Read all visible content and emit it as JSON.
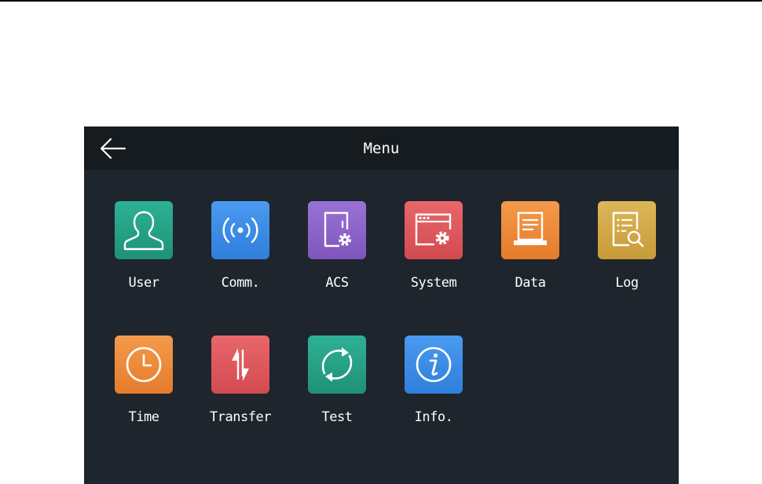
{
  "header": {
    "title": "Menu",
    "back_icon": "arrow-left-icon"
  },
  "menu_items": [
    {
      "id": "user",
      "label": "User",
      "icon": "user-icon",
      "color": "#25a389"
    },
    {
      "id": "comm",
      "label": "Comm.",
      "icon": "wireless-signal-icon",
      "color": "#3d8ee8"
    },
    {
      "id": "acs",
      "label": "ACS",
      "icon": "door-settings-icon",
      "color": "#8c63c9"
    },
    {
      "id": "system",
      "label": "System",
      "icon": "window-settings-icon",
      "color": "#e0575c"
    },
    {
      "id": "data",
      "label": "Data",
      "icon": "document-tray-icon",
      "color": "#ef8a3a"
    },
    {
      "id": "log",
      "label": "Log",
      "icon": "log-search-icon",
      "color": "#d3aa48"
    },
    {
      "id": "time",
      "label": "Time",
      "icon": "clock-icon",
      "color": "#ef8a3a"
    },
    {
      "id": "transfer",
      "label": "Transfer",
      "icon": "transfer-arrows-icon",
      "color": "#e0575c"
    },
    {
      "id": "test",
      "label": "Test",
      "icon": "refresh-cycle-icon",
      "color": "#25a389"
    },
    {
      "id": "info",
      "label": "Info.",
      "icon": "info-icon",
      "color": "#3d8ee8"
    }
  ],
  "colors": {
    "panel_bg": "#1e252c",
    "title_bar_bg": "#161b20",
    "text": "#ffffff"
  }
}
